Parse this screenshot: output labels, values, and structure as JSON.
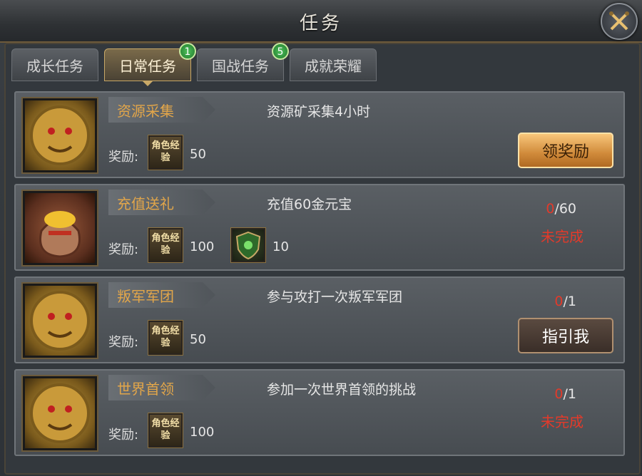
{
  "window": {
    "title": "任务"
  },
  "tabs": [
    {
      "label": "成长任务",
      "badge": ""
    },
    {
      "label": "日常任务",
      "badge": "1"
    },
    {
      "label": "国战任务",
      "badge": "5"
    },
    {
      "label": "成就荣耀",
      "badge": ""
    }
  ],
  "active_tab": 1,
  "reward_label": "奖励:",
  "item_exp_label": "角色经验",
  "tasks": [
    {
      "name": "资源采集",
      "desc": "资源矿采集4小时",
      "portrait_icon": "lion-medal-icon",
      "rewards": [
        {
          "qty": "50"
        }
      ],
      "button": "领奖励"
    },
    {
      "name": "充值送礼",
      "desc": "充值60金元宝",
      "portrait_icon": "gold-bag-icon",
      "rewards": [
        {
          "qty": "100"
        },
        {
          "qty": "10",
          "icon": "green-shield-icon"
        }
      ],
      "progress_cur": "0",
      "progress_total": "/60",
      "status": "未完成"
    },
    {
      "name": "叛军军团",
      "desc": "参与攻打一次叛军军团",
      "portrait_icon": "lion-medal-icon",
      "rewards": [
        {
          "qty": "50"
        }
      ],
      "progress_cur": "0",
      "progress_total": "/1",
      "button": "指引我"
    },
    {
      "name": "世界首领",
      "desc": "参加一次世界首领的挑战",
      "portrait_icon": "lion-medal-icon",
      "rewards": [
        {
          "qty": "100"
        }
      ],
      "progress_cur": "0",
      "progress_total": "/1",
      "status": "未完成"
    }
  ],
  "colors": {
    "accent": "#c8a867",
    "name": "#e2a64a",
    "incomplete": "#e33a2a",
    "badge": "#2fa040"
  }
}
